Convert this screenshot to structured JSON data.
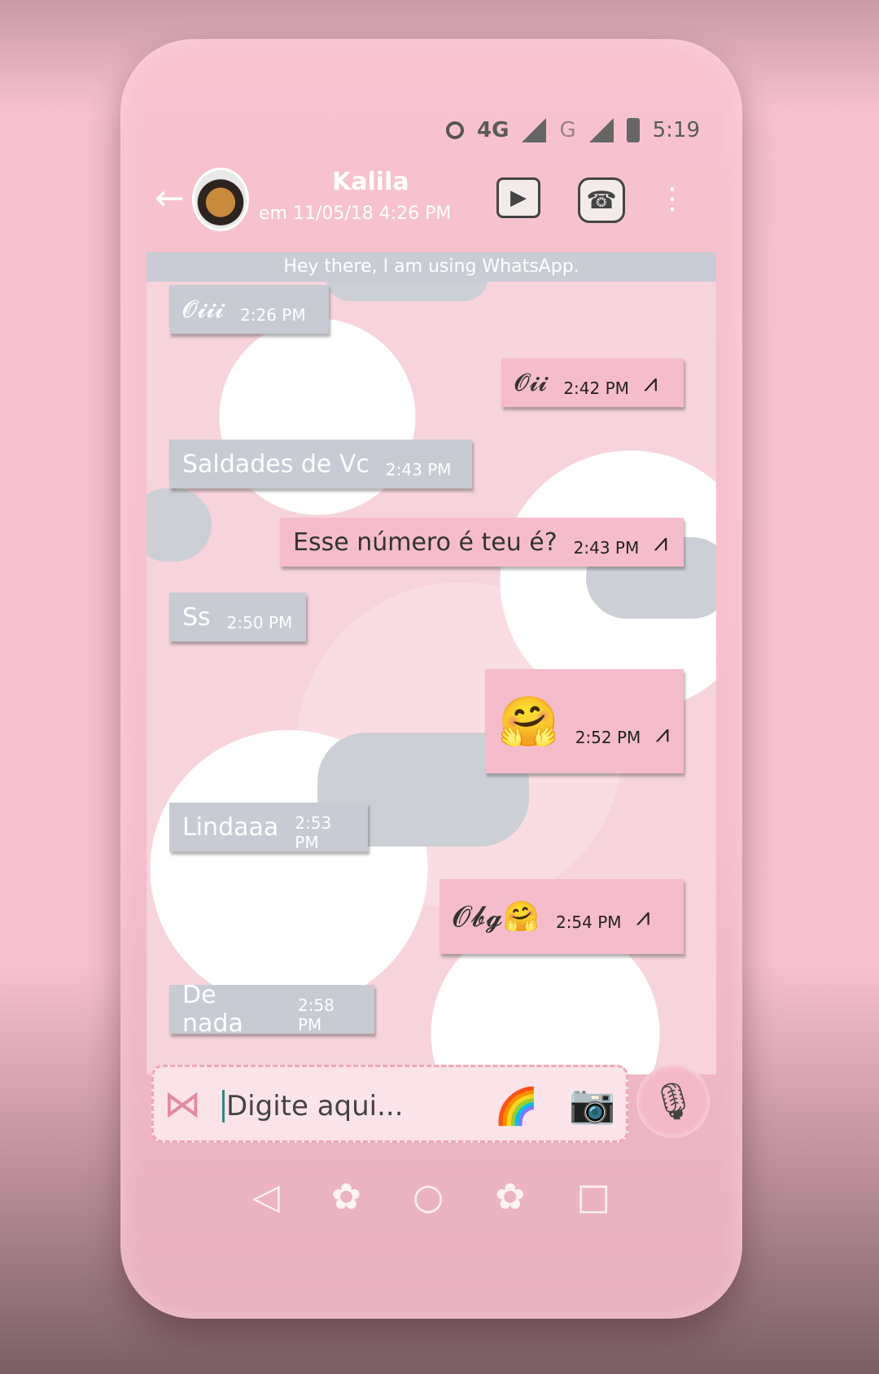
{
  "status_bar": {
    "network": "4G",
    "network2": "G",
    "time": "5:19"
  },
  "header": {
    "contact_name": "Kalila",
    "last_seen": "em 11/05/18 4:26 PM",
    "back_icon": "arrow-left",
    "video_icon": "video-call",
    "call_icon": "telephone",
    "more_icon": "more-vertical"
  },
  "status_banner": "Hey there, I am using WhatsApp.",
  "messages": [
    {
      "dir": "in",
      "text": "𝓞𝓲𝓲𝓲",
      "time": "2:26 PM"
    },
    {
      "dir": "out",
      "text": "𝓞𝓲𝓲",
      "time": "2:42 PM"
    },
    {
      "dir": "in",
      "text": "Saldades de Vc",
      "time": "2:43 PM"
    },
    {
      "dir": "out",
      "text": "Esse número é teu é?",
      "time": "2:43 PM"
    },
    {
      "dir": "in",
      "text": "Ss",
      "time": "2:50 PM"
    },
    {
      "dir": "out",
      "text": "🤗",
      "time": "2:52 PM"
    },
    {
      "dir": "in",
      "text": "Lindaaa",
      "time": "2:53 PM"
    },
    {
      "dir": "out",
      "text": "𝓞𝓫𝓰🤗",
      "time": "2:54 PM"
    },
    {
      "dir": "in",
      "text": "De nada",
      "time": "2:58 PM"
    }
  ],
  "input": {
    "placeholder": "Digite aqui..."
  },
  "icons": {
    "attach": "bow-icon",
    "emoji": "rainbow-icon",
    "camera": "camera-icon",
    "mic": "microphone-icon"
  },
  "nav": {
    "back": "◁",
    "flower": "✿",
    "home": "○",
    "recent": "□"
  }
}
